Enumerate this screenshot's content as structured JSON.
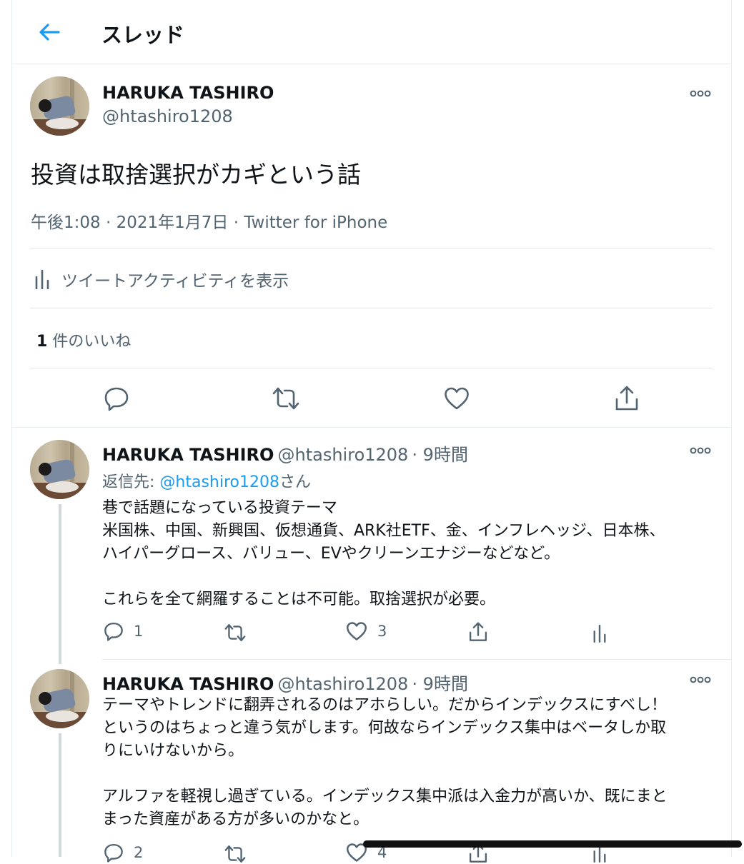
{
  "header": {
    "title": "スレッド"
  },
  "main_tweet": {
    "display_name": "HARUKA TASHIRO",
    "handle": "@htashiro1208",
    "text": "投資は取捨選択がカギという話",
    "timestamp": "午後1:08 · 2021年1月7日 · Twitter for iPhone",
    "activity_label": "ツイートアクティビティを表示",
    "likes_count": "1",
    "likes_label": "件のいいね"
  },
  "replies": [
    {
      "display_name": "HARUKA TASHIRO",
      "handle": "@htashiro1208",
      "time": "· 9時間",
      "reply_to_prefix": "返信先: ",
      "reply_to_handle": "@htashiro1208",
      "reply_to_suffix": "さん",
      "text": "巷で話題になっている投資テーマ\n米国株、中国、新興国、仮想通貨、ARK社ETF、金、インフレヘッジ、日本株、\nハイパーグロース、バリュー、EVやクリーンエナジーなどなど。\n\nこれらを全て網羅することは不可能。取捨選択が必要。",
      "reply_count": "1",
      "like_count": "3"
    },
    {
      "display_name": "HARUKA TASHIRO",
      "handle": "@htashiro1208",
      "time": "· 9時間",
      "text": "テーマやトレンドに翻弄されるのはアホらしい。だからインデックスにすべし！\nというのはちょっと違う気がします。何故ならインデックス集中はベータしか取\nりにいけないから。\n\nアルファを軽視し過ぎている。インデックス集中派は入金力が高いか、既にまと\nまった資産がある方が多いのかなと。",
      "reply_count": "2",
      "like_count": "4"
    }
  ],
  "colors": {
    "accent": "#1d9bf0",
    "muted": "#536471",
    "divider": "#e6ecf0"
  }
}
